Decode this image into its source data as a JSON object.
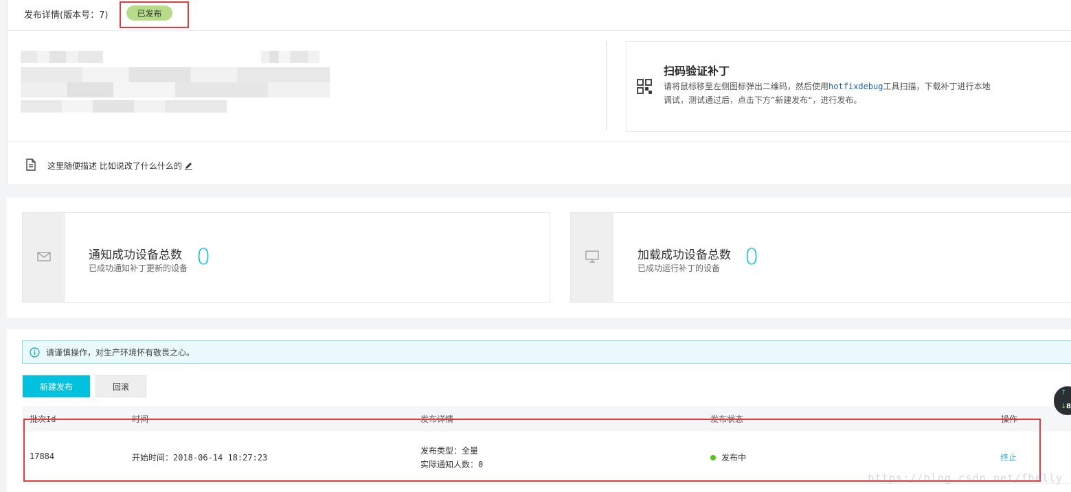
{
  "header": {
    "title": "发布详情(版本号：7)",
    "status_badge": "已发布"
  },
  "qr_card": {
    "title": "扫码验证补丁",
    "desc_line1_pre": "请将鼠标移至左侧图标弹出二维码，然后使用",
    "desc_tool": "hotfixdebug",
    "desc_line1_post": "工具扫描，下载补丁进行本地",
    "desc_line2": "调试，测试通过后，点击下方”新建发布“，进行发布。"
  },
  "description": {
    "text": "这里随便描述 比如说改了什么什么的"
  },
  "stats": [
    {
      "title": "通知成功设备总数",
      "subtitle": "已成功通知补丁更新的设备",
      "value": "0"
    },
    {
      "title": "加载成功设备总数",
      "subtitle": "已成功运行补丁的设备",
      "value": "0"
    }
  ],
  "alert": {
    "text": "请谨慎操作，对生产环境怀有敬畏之心。"
  },
  "actions": {
    "new_release": "新建发布",
    "rollback": "回滚"
  },
  "table": {
    "headers": [
      "批次Id",
      "时间",
      "发布详情",
      "发布状态",
      "操作"
    ],
    "rows": [
      {
        "batch_id": "17884",
        "time": "开始时间：2018-06-14 18:27:23",
        "detail_type": "发布类型：全量",
        "detail_count": "实际通知人数：0",
        "status": "发布中",
        "action": "终止"
      }
    ]
  },
  "colors": {
    "accent": "#00c1de",
    "badge_bg": "#b6dc8a",
    "status_dot": "#52c41a",
    "highlight": "#e8383d",
    "link": "#2ea7e0"
  },
  "icons": {
    "qr": "qr-code-icon",
    "doc": "document-icon",
    "edit": "pencil-icon",
    "mail": "mail-icon",
    "monitor": "monitor-icon",
    "info": "info-icon"
  },
  "floating_widget": {
    "up": "↑",
    "down": "↓",
    "value": "8"
  },
  "watermark": "https://blog.csdn.net/fhelly"
}
